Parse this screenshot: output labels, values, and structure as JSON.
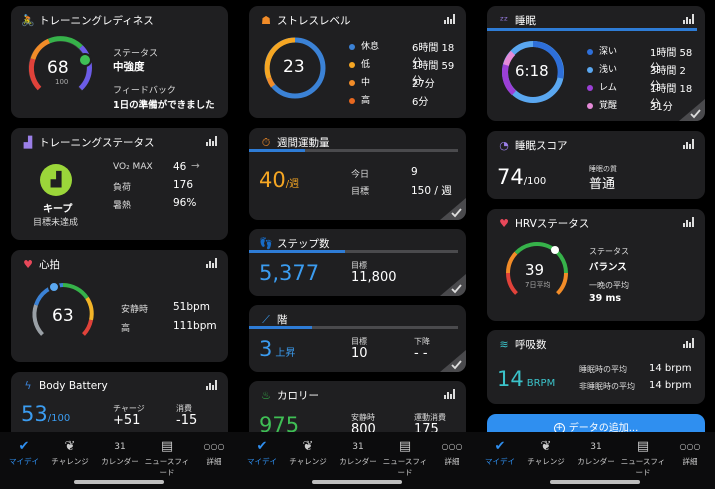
{
  "col1": {
    "readiness": {
      "title": "トレーニングレディネス",
      "score": "68",
      "score_max": "100",
      "status_label": "ステータス",
      "status_value": "中強度",
      "feedback_label": "フィードバック",
      "feedback_value": "1日の準備ができました"
    },
    "training_status": {
      "title": "トレーニングステータス",
      "vo2_label": "VO₂ MAX",
      "vo2_value": "46",
      "vo2_trend": "→",
      "load_label": "負荷",
      "load_value": "176",
      "heat_label": "暑熱",
      "heat_value": "96%",
      "badge": "キープ",
      "sub": "目標未達成"
    },
    "heart": {
      "title": "心拍",
      "value": "63",
      "rest_label": "安静時",
      "rest_value": "51bpm",
      "high_label": "高",
      "high_value": "111bpm"
    },
    "body_battery": {
      "title": "Body Battery",
      "value": "53",
      "unit": "/100",
      "charge_label": "チャージ",
      "charge_value": "+51",
      "drain_label": "消費",
      "drain_value": "-15"
    }
  },
  "col2": {
    "stress": {
      "title": "ストレスレベル",
      "value": "23",
      "rows": [
        {
          "label": "休息",
          "value": "6時間 18分",
          "color": "#3b82d6"
        },
        {
          "label": "低",
          "value": "1時間 59分",
          "color": "#f5a623"
        },
        {
          "label": "中",
          "value": "27分",
          "color": "#f28c28"
        },
        {
          "label": "高",
          "value": "6分",
          "color": "#e8681f"
        }
      ]
    },
    "weekly": {
      "title": "週間運動量",
      "value": "40",
      "unit": "/週",
      "today_label": "今日",
      "today_value": "9",
      "goal_label": "目標",
      "goal_value": "150 / 週",
      "progress": 0.27
    },
    "steps": {
      "title": "ステップ数",
      "value": "5,377",
      "goal_label": "目標",
      "goal_value": "11,800",
      "progress": 0.46
    },
    "floors": {
      "title": "階",
      "value": "3",
      "unit": "上昇",
      "goal_label": "目標",
      "goal_value": "10",
      "down_label": "下降",
      "down_value": "- -",
      "progress": 0.3
    },
    "calories": {
      "title": "カロリー",
      "value": "975",
      "rest_label": "安静時",
      "rest_value": "800",
      "active_label": "運動消費",
      "active_value": "175"
    }
  },
  "col3": {
    "sleep": {
      "title": "睡眠",
      "value": "6:18",
      "rows": [
        {
          "label": "深い",
          "value": "1時間 58分",
          "color": "#2e6fd9"
        },
        {
          "label": "浅い",
          "value": "3時間 2分",
          "color": "#5aa7f0"
        },
        {
          "label": "レム",
          "value": "1時間 18分",
          "color": "#9b3fd6"
        },
        {
          "label": "覚醒",
          "value": "31分",
          "color": "#e58ad8"
        }
      ]
    },
    "sleep_score": {
      "title": "睡眠スコア",
      "value": "74",
      "unit": "/100",
      "quality_label": "睡眠の質",
      "quality_value": "普通"
    },
    "hrv": {
      "title": "HRVステータス",
      "value": "39",
      "sub": "7日平均",
      "status_label": "ステータス",
      "status_value": "バランス",
      "night_label": "一晩の平均",
      "night_value": "39 ms"
    },
    "breathing": {
      "title": "呼吸数",
      "value": "14",
      "unit": "BRPM",
      "sleep_label": "睡眠時の平均",
      "sleep_value": "14 brpm",
      "awake_label": "非睡眠時の平均",
      "awake_value": "14 brpm"
    },
    "add_button": "データの追加..."
  },
  "tabbar": [
    "マイデイ",
    "チャレンジ",
    "カレンダー",
    "ニュースフィード",
    "詳細"
  ],
  "tab_icons": {
    "calendar_day": "31",
    "more": "○○○"
  },
  "colors": {
    "accent": "#2f8ff0",
    "card": "#1f1f21",
    "background": "#000000"
  }
}
